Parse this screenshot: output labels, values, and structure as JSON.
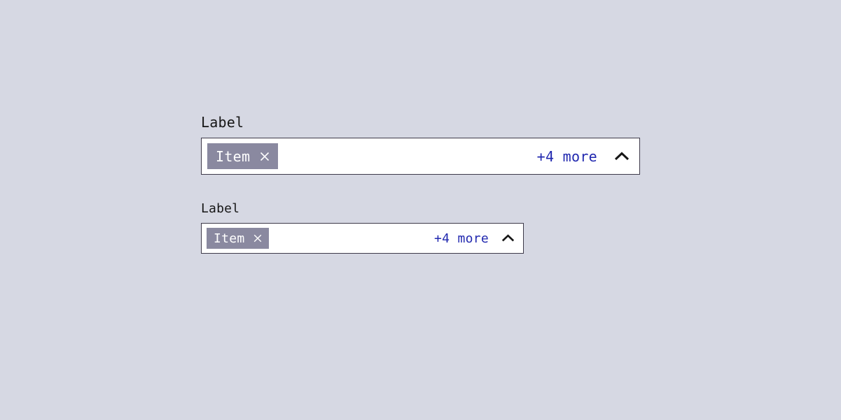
{
  "multiselect_large": {
    "label": "Label",
    "tag_text": "Item",
    "more_text": "+4 more"
  },
  "multiselect_small": {
    "label": "Label",
    "tag_text": "Item",
    "more_text": "+4 more"
  }
}
